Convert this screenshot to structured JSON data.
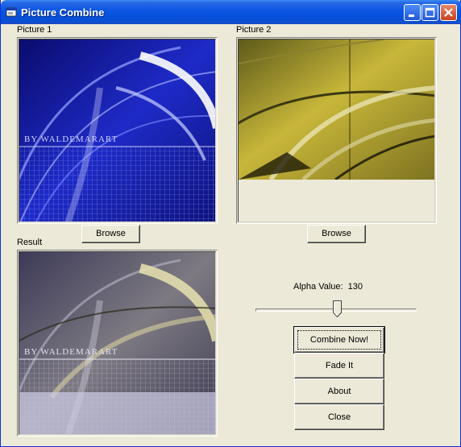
{
  "window": {
    "title": "Picture Combine"
  },
  "labels": {
    "picture1": "Picture 1",
    "picture2": "Picture 2",
    "result": "Result"
  },
  "picture1": {
    "watermark": "BY WALDEMARART"
  },
  "result": {
    "watermark": "BY WALDEMARART"
  },
  "buttons": {
    "browse1": "Browse",
    "browse2": "Browse",
    "combine": "Combine Now!",
    "fade": "Fade It",
    "about": "About",
    "close": "Close"
  },
  "alpha": {
    "label": "Alpha Value:",
    "value": "130",
    "min": 0,
    "max": 255,
    "level": 130
  },
  "icons": {
    "app": "app-window-icon",
    "minimize": "minimize-icon",
    "maximize": "maximize-icon",
    "close": "close-icon"
  },
  "colors": {
    "titlebar": "#0a56e3",
    "face": "#ece9d8",
    "close": "#c8421c"
  }
}
